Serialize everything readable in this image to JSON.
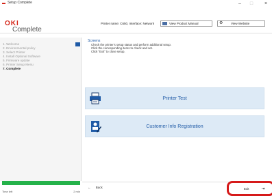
{
  "window": {
    "title": "Setup Complete",
    "minimize": "–",
    "maximize": "□",
    "close": "×"
  },
  "header": {
    "logo": "OKI",
    "page_title": "Complete",
    "printer_info": "Printer name: C650, Interface: Network",
    "view_manual": "View Product Manual",
    "view_website": "View Website"
  },
  "sidebar": {
    "items": [
      "1. Welcome",
      "2. Environmental policy",
      "3. Select Printer",
      "4. Install Optional Software",
      "5. Firmware update",
      "6. Printer Setup Menu",
      "7. Complete"
    ],
    "current_index": 6
  },
  "progress": {
    "fraction": 1.0,
    "color": "#25b24a",
    "time_left_label": "Time left",
    "time_left_value": "2 min"
  },
  "main": {
    "section_title": "Screens",
    "description": [
      "Check the printer's setup status and perform additional setup.",
      "Click the corresponding items to check and set.",
      "Click \"Exit\" to close setup."
    ],
    "cards": [
      {
        "label": "Printer Test",
        "icon": "printer-icon"
      },
      {
        "label": "Customer Info Registration",
        "icon": "registration-icon"
      }
    ]
  },
  "footer": {
    "back": "Back",
    "exit": "Exit"
  },
  "colors": {
    "accent": "#1f5aa6",
    "brand": "#d4271a",
    "highlight": "#d61a1a"
  }
}
